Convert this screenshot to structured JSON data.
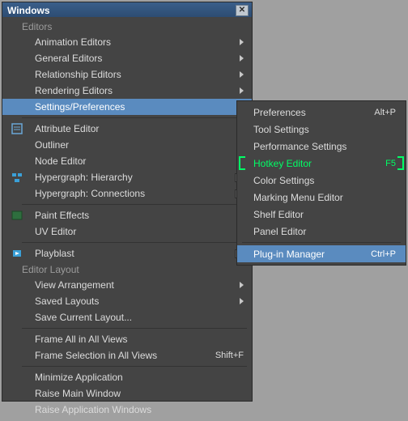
{
  "window": {
    "title": "Windows"
  },
  "sections": {
    "editors": "Editors",
    "editor_layout": "Editor Layout"
  },
  "menu": {
    "animation_editors": "Animation Editors",
    "general_editors": "General Editors",
    "relationship_editors": "Relationship Editors",
    "rendering_editors": "Rendering Editors",
    "settings_preferences": "Settings/Preferences",
    "attribute_editor": "Attribute Editor",
    "outliner": "Outliner",
    "node_editor": "Node Editor",
    "hypergraph_hierarchy": "Hypergraph: Hierarchy",
    "hypergraph_connections": "Hypergraph: Connections",
    "paint_effects": "Paint Effects",
    "uv_editor": "UV Editor",
    "playblast": "Playblast",
    "view_arrangement": "View Arrangement",
    "saved_layouts": "Saved Layouts",
    "save_current_layout": "Save Current Layout...",
    "frame_all": "Frame All in All Views",
    "frame_selection": "Frame Selection in All Views",
    "frame_selection_shortcut": "Shift+F",
    "minimize_application": "Minimize Application",
    "raise_main_window": "Raise Main Window",
    "raise_application_windows": "Raise Application Windows"
  },
  "submenu": {
    "preferences": "Preferences",
    "preferences_shortcut": "Alt+P",
    "tool_settings": "Tool Settings",
    "performance_settings": "Performance Settings",
    "hotkey_editor": "Hotkey Editor",
    "hotkey_editor_shortcut": "F5",
    "color_settings": "Color Settings",
    "marking_menu_editor": "Marking Menu Editor",
    "shelf_editor": "Shelf Editor",
    "panel_editor": "Panel Editor",
    "plugin_manager": "Plug-in Manager",
    "plugin_manager_shortcut": "Ctrl+P"
  }
}
